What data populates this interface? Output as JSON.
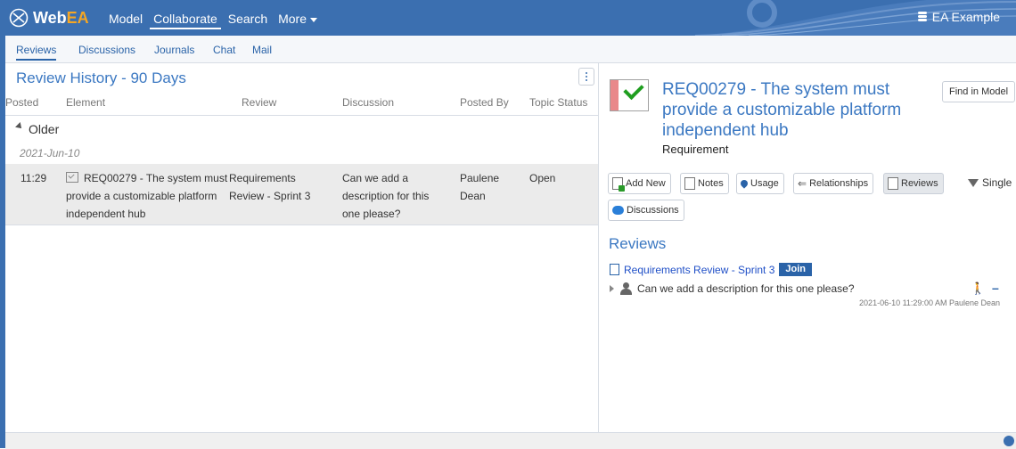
{
  "app": {
    "logo_text_main": "Web",
    "logo_text_accent": "EA",
    "model_name": "EA Example"
  },
  "topnav": [
    "Model",
    "Collaborate",
    "Search",
    "More"
  ],
  "subnav": [
    "Reviews",
    "Discussions",
    "Journals",
    "Chat",
    "Mail"
  ],
  "left": {
    "title": "Review History - 90 Days",
    "columns": [
      "Posted",
      "Element",
      "Review",
      "Discussion",
      "Posted By",
      "Topic Status"
    ],
    "group": "Older",
    "date": "2021-Jun-10",
    "row": {
      "posted": "11:29",
      "element": "REQ00279 - The system must provide a customizable platform independent hub",
      "review": "Requirements Review - Sprint 3",
      "discussion": "Can we add a description for this one please?",
      "posted_by": "Paulene Dean",
      "status": "Open"
    }
  },
  "right": {
    "title": "REQ00279 - The system must provide a customizable platform independent hub",
    "type": "Requirement",
    "find_in_model": "Find in Model",
    "toolbar": {
      "add_new": "Add New",
      "notes": "Notes",
      "usage": "Usage",
      "relationships": "Relationships",
      "reviews": "Reviews",
      "discussions": "Discussions",
      "single": "Single"
    },
    "reviews_heading": "Reviews",
    "review_link": "Requirements Review - Sprint 3",
    "join_label": "Join",
    "discussion_text": "Can we add a description for this one please?",
    "discussion_meta": "2021-06-10 11:29:00 AM  Paulene Dean"
  },
  "colors": {
    "brand": "#3b6fb0",
    "link": "#3b78c2",
    "join": "#2a63a8",
    "check": "#1f9e1f"
  },
  "icons": [
    "webea-logo-icon",
    "database-icon",
    "more-icon",
    "element-icon",
    "requirement-icon",
    "add-new-icon",
    "notes-icon",
    "usage-icon",
    "relationships-icon",
    "reviews-icon",
    "filter-icon",
    "discussions-icon",
    "review-doc-icon",
    "expander-icon",
    "person-icon",
    "walk-icon",
    "minus-icon",
    "status-icon"
  ]
}
